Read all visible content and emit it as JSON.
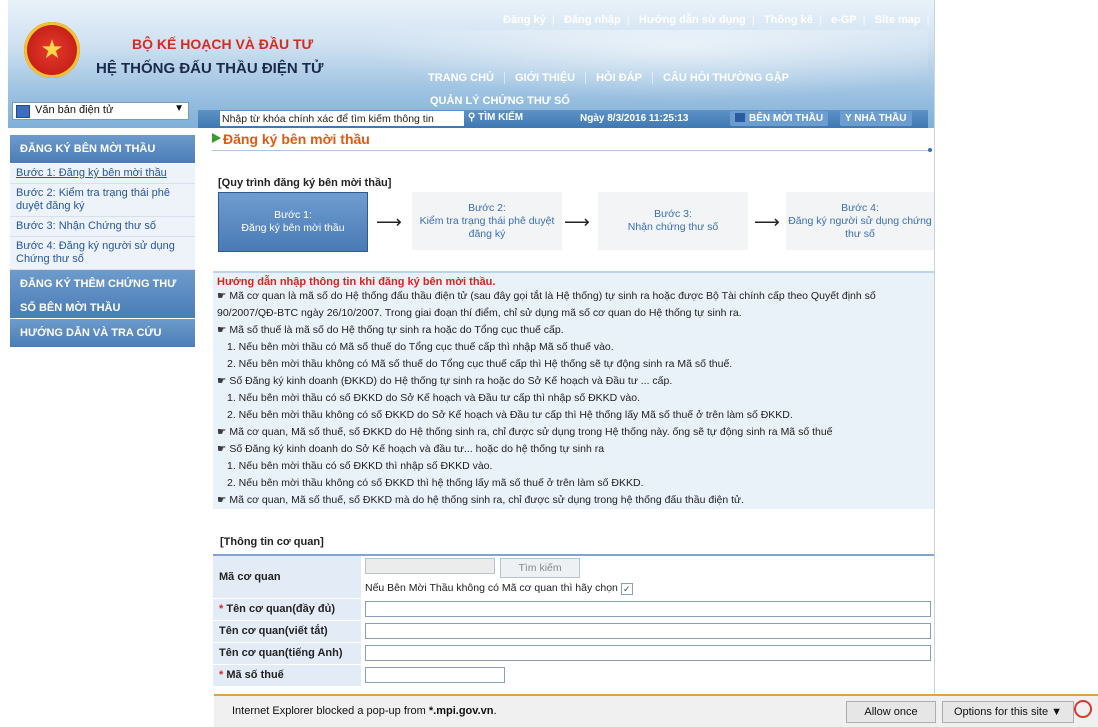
{
  "header": {
    "org_name": "BỘ KẾ HOẠCH VÀ ĐẦU TƯ",
    "system_name": "HỆ THỐNG ĐẤU THẦU ĐIỆN TỬ",
    "emblem_glyph": "★",
    "top_links": [
      "Đăng ký",
      "Đăng nhập",
      "Hướng dẫn sử dụng",
      "Thống kê",
      "e-GP",
      "Site map"
    ],
    "top_sep": "|",
    "main_nav": [
      "TRANG CHỦ",
      "GIỚI THIỆU",
      "HỎI ĐÁP",
      "CÂU HỎI THƯỜNG GẶP"
    ],
    "main_nav_2": "QUẢN LÝ CHỨNG THƯ SỐ"
  },
  "toolbar": {
    "select_value": "Văn bản điện tử",
    "select_arrow": "▼",
    "search_placeholder": "Nhập từ khóa chính xác để tìm kiếm thông tin",
    "search_button": "TÌM KIẾM",
    "search_glyph": "⚲",
    "date_text": "Ngày 8/3/2016 11:25:13",
    "btn_moi_thau": "BÊN MỜI THẦU",
    "btn_nha_thau": "NHÀ THẦU",
    "nha_thau_glyph": "Y"
  },
  "sidebar": {
    "section1": "ĐĂNG KÝ BÊN MỜI THẦU",
    "items": [
      "Bước 1: Đăng ký bên mời thầu",
      "Bước 2: Kiểm tra trạng thái phê duyệt đăng ký",
      "Bước 3: Nhận Chứng thư số",
      "Bước 4: Đăng ký người sử dụng Chứng thư số"
    ],
    "section2a": "ĐĂNG KÝ THÊM CHỨNG THƯ",
    "section2b": "SỐ BÊN MỜI THẦU",
    "section3": "HƯỚNG DẪN VÀ TRA CỨU"
  },
  "main": {
    "page_title": "Đăng ký bên mời thầu",
    "process_title": "[Quy trình đăng ký bên mời thầu]",
    "arrow_glyph": "⟶",
    "steps": [
      {
        "num": "Bước 1:",
        "text": "Đăng ký bên mời thầu"
      },
      {
        "num": "Bước 2:",
        "text": "Kiểm tra trạng thái phê duyệt đăng ký"
      },
      {
        "num": "Bước 3:",
        "text": "Nhận chứng thư số"
      },
      {
        "num": "Bước 4:",
        "text": "Đăng ký người sử dụng chứng thư số"
      }
    ],
    "guide_title": "Hướng dẫn nhập thông tin khi đăng ký bên mời thầu.",
    "hand_glyph": "☛",
    "guide_lines": [
      {
        "h": true,
        "t": "Mã cơ quan là mã số do Hệ thống đấu thầu điện tử (sau đây gọi tắt là Hệ thống) tự sinh ra hoặc được Bộ Tài chính cấp theo Quyết định số"
      },
      {
        "h": false,
        "t": "90/2007/QĐ-BTC ngày 26/10/2007. Trong giai đoạn thí điểm, chỉ sử dụng mã số cơ quan do Hệ thống tự sinh ra."
      },
      {
        "h": true,
        "t": "Mã số thuế là mã số do Hệ thống tự sinh ra hoặc do Tổng cục thuế cấp."
      },
      {
        "h": false,
        "i": true,
        "t": "1. Nếu bên mời thầu có Mã số thuế do Tổng cục thuế cấp thì nhập Mã số thuế vào."
      },
      {
        "h": false,
        "i": true,
        "t": "2. Nếu bên mời thầu không có Mã số thuế do Tổng cục thuế cấp thì Hệ thống sẽ tự động sinh ra Mã số thuế."
      },
      {
        "h": true,
        "t": "Số Đăng ký kinh doanh (ĐKKD) do Hệ thống tự sinh ra hoặc do Sở Kế hoạch và Đầu tư ... cấp."
      },
      {
        "h": false,
        "i": true,
        "t": "1. Nếu bên mời thầu có số ĐKKD do Sở Kế hoạch và Đầu tư cấp thì nhập số ĐKKD vào."
      },
      {
        "h": false,
        "i": true,
        "t": "2. Nếu bên mời thầu không có số ĐKKD do Sở Kế hoạch và Đầu tư cấp thì Hệ thống lấy Mã số thuế ở trên làm số ĐKKD."
      },
      {
        "h": true,
        "t": "Mã cơ quan, Mã số thuế, số ĐKKD do Hệ thống sinh ra, chỉ được sử dụng trong Hệ thống này. ống sẽ tự động sinh ra Mã số thuế"
      },
      {
        "h": true,
        "t": "Số Đăng ký kinh doanh do Sở Kế hoạch và đầu tư... hoặc do hệ thống tự sinh ra"
      },
      {
        "h": false,
        "i": true,
        "t": "1. Nếu bên mời thầu có số ĐKKD thì nhập số ĐKKD vào."
      },
      {
        "h": false,
        "i": true,
        "t": "2. Nếu bên mời thầu không có số ĐKKD thì hệ thống lấy mã số thuế ở trên làm số ĐKKD."
      },
      {
        "h": true,
        "t": "Mã cơ quan, Mã số thuế, số ĐKKD mà do hệ thống sinh ra, chỉ được sử dụng trong hệ thống đấu thầu điện tử."
      }
    ],
    "info_title": "[Thông tin cơ quan]",
    "form": {
      "ma_co_quan_label": "Mã cơ quan",
      "tim_kiem": "Tìm kiếm",
      "checkbox_note": "Nếu Bên Mời Thầu không có Mã cơ quan thì hãy chọn",
      "check_glyph": "✓",
      "req_mark": "*",
      "ten_day_du": "Tên cơ quan(đầy đủ)",
      "ten_viet_tat": "Tên cơ quan(viết tắt)",
      "ten_tieng_anh": "Tên cơ quan(tiếng Anh)",
      "partial_label": "Mã số thuế"
    }
  },
  "popup": {
    "message_prefix": "Internet Explorer blocked a pop-up from ",
    "message_domain": "*.mpi.gov.vn",
    "message_suffix": ".",
    "allow_once": "Allow once",
    "options": "Options for this site ▼"
  }
}
